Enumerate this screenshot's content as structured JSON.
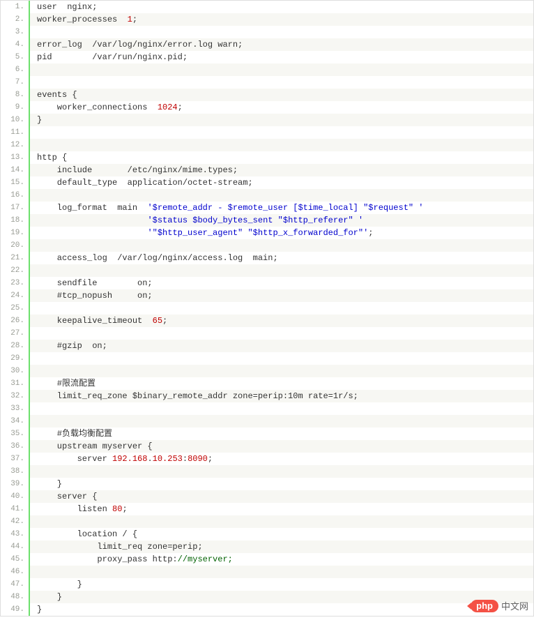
{
  "lines": [
    {
      "n": "1.",
      "segs": [
        {
          "t": "user  nginx;"
        }
      ]
    },
    {
      "n": "2.",
      "segs": [
        {
          "t": "worker_processes  "
        },
        {
          "t": "1",
          "c": "tok-num"
        },
        {
          "t": ";"
        }
      ]
    },
    {
      "n": "3.",
      "segs": [
        {
          "t": " "
        }
      ]
    },
    {
      "n": "4.",
      "segs": [
        {
          "t": "error_log  /var/log/nginx/error.log warn;"
        }
      ]
    },
    {
      "n": "5.",
      "segs": [
        {
          "t": "pid        /var/run/nginx.pid;"
        }
      ]
    },
    {
      "n": "6.",
      "segs": [
        {
          "t": " "
        }
      ]
    },
    {
      "n": "7.",
      "segs": [
        {
          "t": " "
        }
      ]
    },
    {
      "n": "8.",
      "segs": [
        {
          "t": "events {"
        }
      ]
    },
    {
      "n": "9.",
      "segs": [
        {
          "t": "    worker_connections  "
        },
        {
          "t": "1024",
          "c": "tok-num"
        },
        {
          "t": ";"
        }
      ]
    },
    {
      "n": "10.",
      "segs": [
        {
          "t": "}"
        }
      ]
    },
    {
      "n": "11.",
      "segs": [
        {
          "t": " "
        }
      ]
    },
    {
      "n": "12.",
      "segs": [
        {
          "t": " "
        }
      ]
    },
    {
      "n": "13.",
      "segs": [
        {
          "t": "http {"
        }
      ]
    },
    {
      "n": "14.",
      "segs": [
        {
          "t": "    include       /etc/nginx/mime.types;"
        }
      ]
    },
    {
      "n": "15.",
      "segs": [
        {
          "t": "    default_type  application/octet-stream;"
        }
      ]
    },
    {
      "n": "16.",
      "segs": [
        {
          "t": " "
        }
      ]
    },
    {
      "n": "17.",
      "segs": [
        {
          "t": "    log_format  main  "
        },
        {
          "t": "'$remote_addr - $remote_user [$time_local] \"$request\" '",
          "c": "tok-str"
        }
      ]
    },
    {
      "n": "18.",
      "segs": [
        {
          "t": "                      "
        },
        {
          "t": "'$status $body_bytes_sent \"$http_referer\" '",
          "c": "tok-str"
        }
      ]
    },
    {
      "n": "19.",
      "segs": [
        {
          "t": "                      "
        },
        {
          "t": "'\"$http_user_agent\" \"$http_x_forwarded_for\"'",
          "c": "tok-str"
        },
        {
          "t": ";"
        }
      ]
    },
    {
      "n": "20.",
      "segs": [
        {
          "t": " "
        }
      ]
    },
    {
      "n": "21.",
      "segs": [
        {
          "t": "    access_log  /var/log/nginx/access.log  main;"
        }
      ]
    },
    {
      "n": "22.",
      "segs": [
        {
          "t": " "
        }
      ]
    },
    {
      "n": "23.",
      "segs": [
        {
          "t": "    sendfile        on;"
        }
      ]
    },
    {
      "n": "24.",
      "segs": [
        {
          "t": "    #tcp_nopush     on;"
        }
      ]
    },
    {
      "n": "25.",
      "segs": [
        {
          "t": " "
        }
      ]
    },
    {
      "n": "26.",
      "segs": [
        {
          "t": "    keepalive_timeout  "
        },
        {
          "t": "65",
          "c": "tok-num"
        },
        {
          "t": ";"
        }
      ]
    },
    {
      "n": "27.",
      "segs": [
        {
          "t": " "
        }
      ]
    },
    {
      "n": "28.",
      "segs": [
        {
          "t": "    #gzip  on;"
        }
      ]
    },
    {
      "n": "29.",
      "segs": [
        {
          "t": " "
        }
      ]
    },
    {
      "n": "30.",
      "segs": [
        {
          "t": " "
        }
      ]
    },
    {
      "n": "31.",
      "segs": [
        {
          "t": "    #限流配置"
        }
      ]
    },
    {
      "n": "32.",
      "segs": [
        {
          "t": "    limit_req_zone $binary_remote_addr zone=perip:10m rate=1r/s;"
        }
      ]
    },
    {
      "n": "33.",
      "segs": [
        {
          "t": " "
        }
      ]
    },
    {
      "n": "34.",
      "segs": [
        {
          "t": " "
        }
      ]
    },
    {
      "n": "35.",
      "segs": [
        {
          "t": "    #负载均衡配置"
        }
      ]
    },
    {
      "n": "36.",
      "segs": [
        {
          "t": "    upstream myserver {"
        }
      ]
    },
    {
      "n": "37.",
      "segs": [
        {
          "t": "        server "
        },
        {
          "t": "192.168",
          "c": "tok-num"
        },
        {
          "t": "."
        },
        {
          "t": "10.253",
          "c": "tok-num"
        },
        {
          "t": ":"
        },
        {
          "t": "8090",
          "c": "tok-num"
        },
        {
          "t": ";"
        }
      ]
    },
    {
      "n": "38.",
      "segs": [
        {
          "t": " "
        }
      ]
    },
    {
      "n": "39.",
      "segs": [
        {
          "t": "    }"
        }
      ]
    },
    {
      "n": "40.",
      "segs": [
        {
          "t": "    server {"
        }
      ]
    },
    {
      "n": "41.",
      "segs": [
        {
          "t": "        listen "
        },
        {
          "t": "80",
          "c": "tok-num"
        },
        {
          "t": ";"
        }
      ]
    },
    {
      "n": "42.",
      "segs": [
        {
          "t": " "
        }
      ]
    },
    {
      "n": "43.",
      "segs": [
        {
          "t": "        location / {"
        }
      ]
    },
    {
      "n": "44.",
      "segs": [
        {
          "t": "            limit_req zone=perip;"
        }
      ]
    },
    {
      "n": "45.",
      "segs": [
        {
          "t": "            proxy_pass http:"
        },
        {
          "t": "//myserver;",
          "c": "tok-cmt"
        }
      ]
    },
    {
      "n": "46.",
      "segs": [
        {
          "t": " "
        }
      ]
    },
    {
      "n": "47.",
      "segs": [
        {
          "t": "        }"
        }
      ]
    },
    {
      "n": "48.",
      "segs": [
        {
          "t": "    }"
        }
      ]
    },
    {
      "n": "49.",
      "segs": [
        {
          "t": "}"
        }
      ]
    }
  ],
  "watermark": {
    "pill": "php",
    "text": "中文网"
  }
}
